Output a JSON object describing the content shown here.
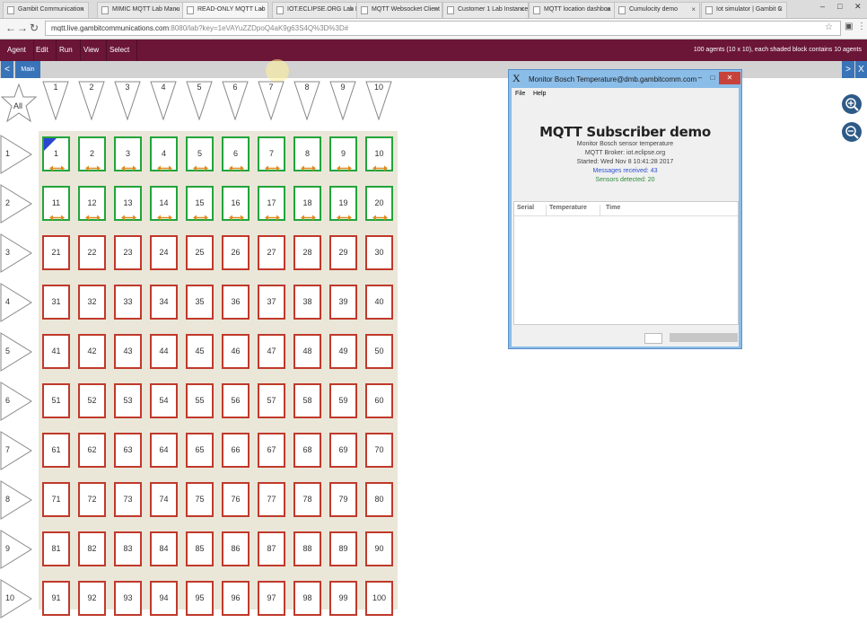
{
  "browser": {
    "tabs": [
      {
        "label": "Gambit Communication"
      },
      {
        "label": "MIMIC MQTT Lab Manu"
      },
      {
        "label": "READ-ONLY MQTT Lab"
      },
      {
        "label": "IOT.ECLIPSE.ORG Lab In"
      },
      {
        "label": "MQTT Websocket Client"
      },
      {
        "label": "Customer 1 Lab Instance"
      },
      {
        "label": "MQTT location dashboa"
      },
      {
        "label": "Cumulocity demo"
      },
      {
        "label": "Iot simulator | Gambit C"
      }
    ],
    "url_host": "mqtt.live.gambitcommunications.com",
    "url_rest": ":8080/lab?key=1eVAYuZZDpoQ4aK9g63S4Q%3D%3D#"
  },
  "app": {
    "menu": [
      "Agent",
      "Edit",
      "Run",
      "View",
      "Select"
    ],
    "info": "100 agents (10 x 10), each shaded block contains 10 agents",
    "tab_label": "Main",
    "nav_left": "<",
    "nav_right": ">",
    "close_label": "X"
  },
  "grid": {
    "all_label": "All",
    "columns": [
      "1",
      "2",
      "3",
      "4",
      "5",
      "6",
      "7",
      "8",
      "9",
      "10"
    ],
    "rows": [
      "1",
      "2",
      "3",
      "4",
      "5",
      "6",
      "7",
      "8",
      "9",
      "10"
    ],
    "green_agents": 20,
    "running_agent": 1
  },
  "subscriber_window": {
    "title": "Monitor Bosch Temperature@dmb.gambitcomm.com",
    "menu": [
      "File",
      "Help"
    ],
    "heading": "MQTT Subscriber demo",
    "line1": "Monitor Bosch sensor temperature",
    "line2": "MQTT Broker: iot.eclipse.org",
    "line3": "Started: Wed Nov  8 10:41:28 2017",
    "messages": "Messages received: 43",
    "sensors": "Sensors detected: 20",
    "columns": [
      "Serial",
      "Temperature",
      "Time"
    ]
  },
  "colors": {
    "menubar": "#6b1637",
    "tabstrip_accent": "#3a74b8",
    "agent_green": "#22a53a",
    "agent_red": "#c0392b",
    "grid_background": "#eae7d9"
  }
}
